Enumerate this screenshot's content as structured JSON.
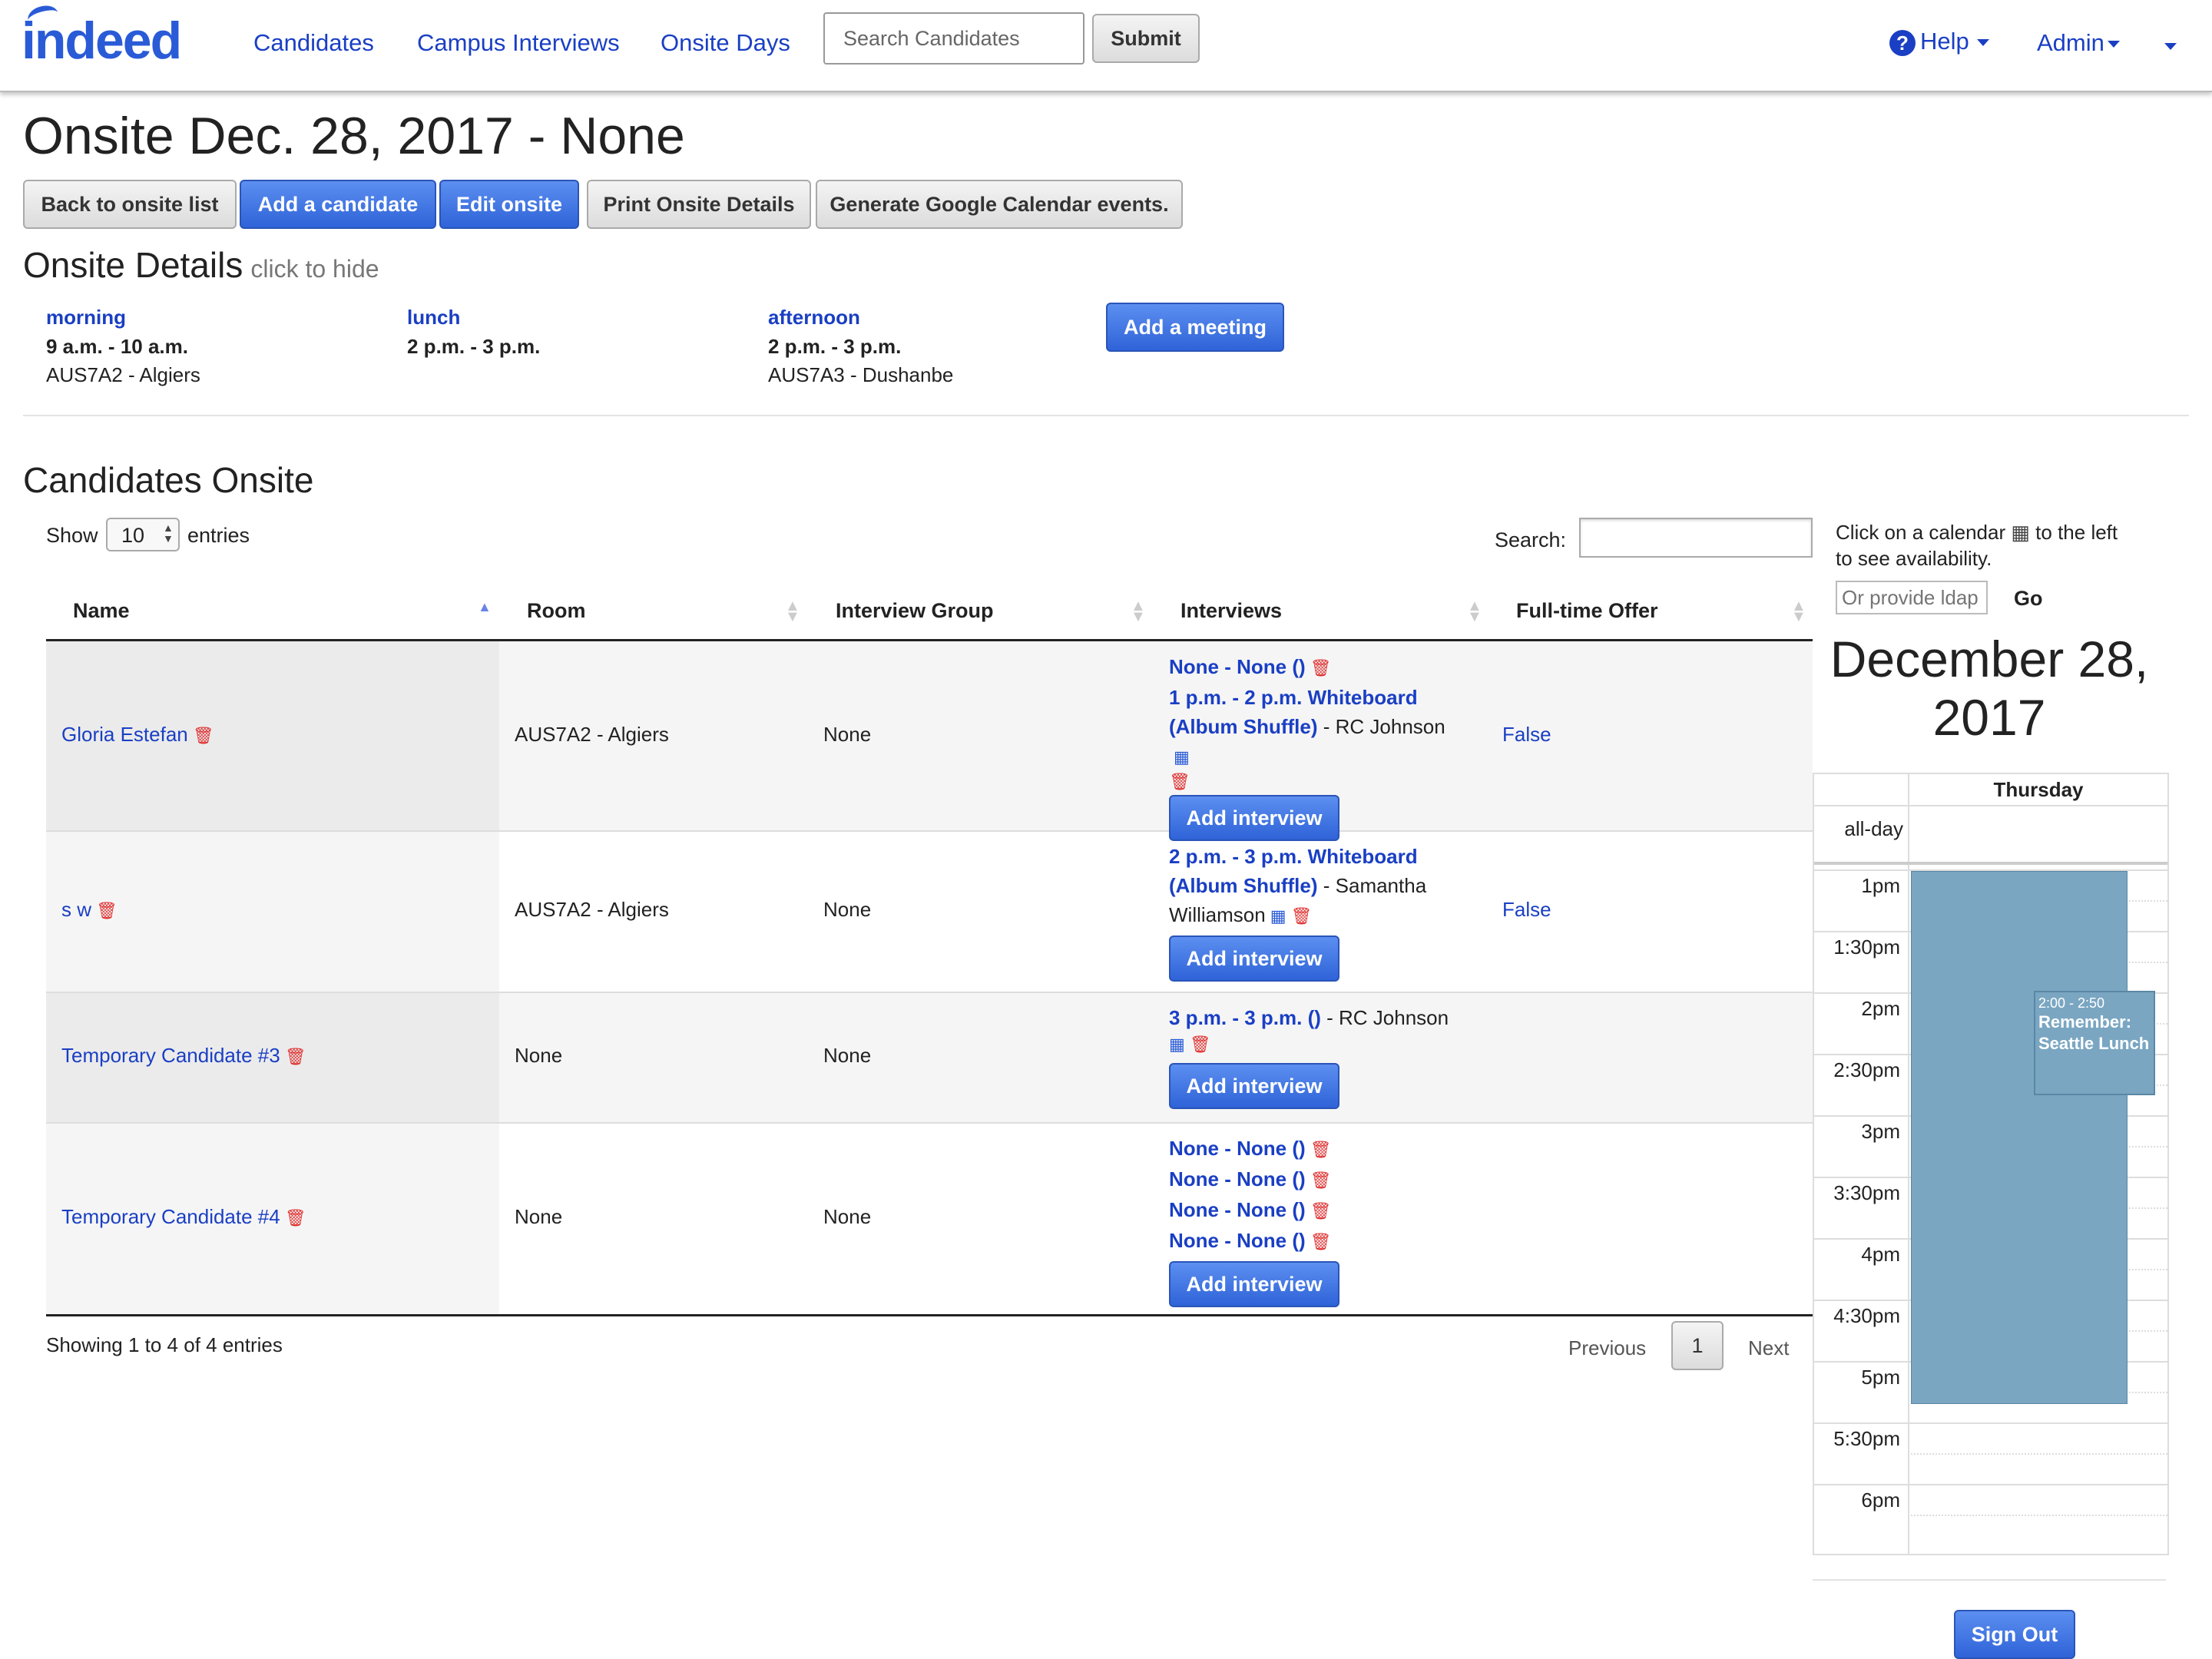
{
  "nav": {
    "logo": "indeed",
    "links": [
      "Candidates",
      "Campus Interviews",
      "Onsite Days"
    ],
    "search_placeholder": "Search Candidates",
    "submit_label": "Submit",
    "help_label": "Help",
    "admin_label": "Admin"
  },
  "page": {
    "title": "Onsite Dec. 28, 2017 - None",
    "buttons": {
      "back": "Back to onsite list",
      "add_candidate": "Add a candidate",
      "edit_onsite": "Edit onsite",
      "print": "Print Onsite Details",
      "gcal": "Generate Google Calendar events."
    }
  },
  "details": {
    "title": "Onsite Details",
    "hint": "click to hide",
    "slots": [
      {
        "name": "morning",
        "time": "9 a.m. - 10 a.m.",
        "room": "AUS7A2 - Algiers"
      },
      {
        "name": "lunch",
        "time": "2 p.m. - 3 p.m.",
        "room": ""
      },
      {
        "name": "afternoon",
        "time": "2 p.m. - 3 p.m.",
        "room": "AUS7A3 - Dushanbe"
      }
    ],
    "add_meeting": "Add a meeting"
  },
  "candidates": {
    "title": "Candidates Onsite",
    "show_label": "Show",
    "entries_value": "10",
    "entries_label": "entries",
    "search_label": "Search:",
    "columns": [
      "Name",
      "Room",
      "Interview Group",
      "Interviews",
      "Full-time Offer"
    ],
    "add_interview_label": "Add interview",
    "rows": [
      {
        "name": "Gloria Estefan",
        "room": "AUS7A2 - Algiers",
        "group": "None",
        "offer": "False",
        "i1": "None - None ()",
        "i2": "1 p.m. - 2 p.m. Whiteboard",
        "i3": "(Album Shuffle)",
        "i3b": " - RC Johnson"
      },
      {
        "name": "s w",
        "room": "AUS7A2 - Algiers",
        "group": "None",
        "offer": "False",
        "i1": "2 p.m. - 3 p.m. Whiteboard",
        "i2": "(Album Shuffle)",
        "i2b": " - Samantha",
        "i3": "Williamson"
      },
      {
        "name": "Temporary Candidate #3",
        "room": "None",
        "group": "None",
        "offer": "",
        "i1": "3 p.m. - 3 p.m. ()",
        "i1b": " - RC Johnson"
      },
      {
        "name": "Temporary Candidate #4",
        "room": "None",
        "group": "None",
        "offer": "",
        "i1": "None - None ()",
        "i2": "None - None ()",
        "i3": "None - None ()",
        "i4": "None - None ()"
      }
    ],
    "info": "Showing 1 to 4 of 4 entries",
    "pagination": {
      "previous": "Previous",
      "page": "1",
      "next": "Next"
    }
  },
  "sidebar": {
    "hint_a": "Click on a calendar",
    "hint_b": "to the left",
    "hint_c": "to see availability.",
    "ldap_placeholder": "Or provide ldap",
    "go_label": "Go",
    "date_line1": "December 28,",
    "date_line2": "2017",
    "day_header": "Thursday",
    "allday_label": "all-day",
    "times": [
      "1pm",
      "1:30pm",
      "2pm",
      "2:30pm",
      "3pm",
      "3:30pm",
      "4pm",
      "4:30pm",
      "5pm",
      "5:30pm",
      "6pm"
    ],
    "event": {
      "time": "2:00 - 2:50",
      "title": "Remember: Seattle Lunch"
    },
    "sign_out": "Sign Out"
  },
  "colors": {
    "link": "#1a3fc4",
    "primary_button": "#2f63d8",
    "event_block": "#7aa6c2",
    "trash": "#e03030"
  }
}
